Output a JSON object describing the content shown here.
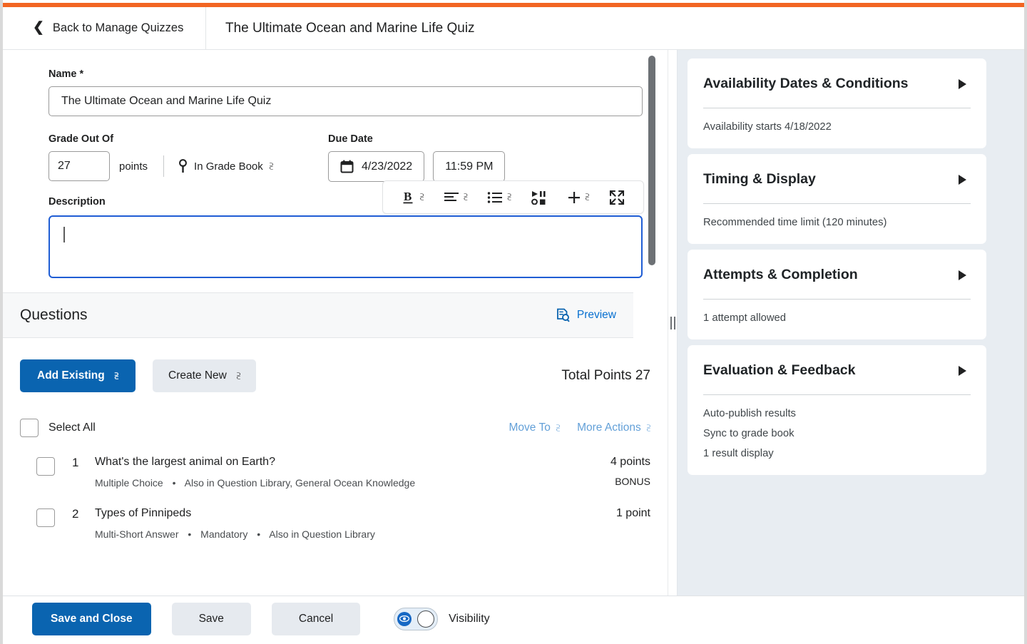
{
  "header": {
    "back_label": "Back to Manage Quizzes",
    "title": "The Ultimate Ocean and Marine Life Quiz"
  },
  "form": {
    "name_label": "Name *",
    "name_value": "The Ultimate Ocean and Marine Life Quiz",
    "grade_out_of_label": "Grade Out Of",
    "points_value": "27",
    "points_word": "points",
    "gradebook_label": "In Grade Book",
    "due_date_label": "Due Date",
    "due_date_value": "4/23/2022",
    "due_time_value": "11:59 PM",
    "description_label": "Description",
    "description_value": ""
  },
  "rte_toolbar": {
    "bold": "B",
    "items": [
      "bold-icon",
      "align-left-icon",
      "bullet-list-icon",
      "media-icon",
      "plus-icon",
      "expand-icon"
    ]
  },
  "questions": {
    "section_title": "Questions",
    "preview_label": "Preview",
    "add_existing_label": "Add Existing",
    "create_new_label": "Create New",
    "total_points_label": "Total Points 27",
    "select_all_label": "Select All",
    "move_to_label": "Move To",
    "more_actions_label": "More Actions",
    "items": [
      {
        "number": "1",
        "title": "What's the largest animal on Earth?",
        "type": "Multiple Choice",
        "meta": "Also in Question Library, General Ocean Knowledge",
        "points": "4 points",
        "badge": "BONUS"
      },
      {
        "number": "2",
        "title": "Types of Pinnipeds",
        "type": "Multi-Short Answer",
        "meta": "Mandatory",
        "meta2": "Also in Question Library",
        "points": "1 point",
        "badge": ""
      }
    ]
  },
  "sidebar": {
    "panels": [
      {
        "title": "Availability Dates & Conditions",
        "lines": [
          "Availability starts 4/18/2022"
        ]
      },
      {
        "title": "Timing & Display",
        "lines": [
          "Recommended time limit (120 minutes)"
        ]
      },
      {
        "title": "Attempts & Completion",
        "lines": [
          "1 attempt allowed"
        ]
      },
      {
        "title": "Evaluation & Feedback",
        "lines": [
          "Auto-publish results",
          "Sync to grade book",
          "1 result display"
        ]
      }
    ]
  },
  "footer": {
    "save_and_close_label": "Save and Close",
    "save_label": "Save",
    "cancel_label": "Cancel",
    "visibility_label": "Visibility"
  },
  "colors": {
    "accent_orange": "#f26522",
    "primary_blue": "#0a64b0",
    "link_blue": "#066fd0",
    "muted_link_blue": "#63a0d8",
    "sidebar_bg": "#e8edf2",
    "focus_border": "#1f5dd4"
  }
}
